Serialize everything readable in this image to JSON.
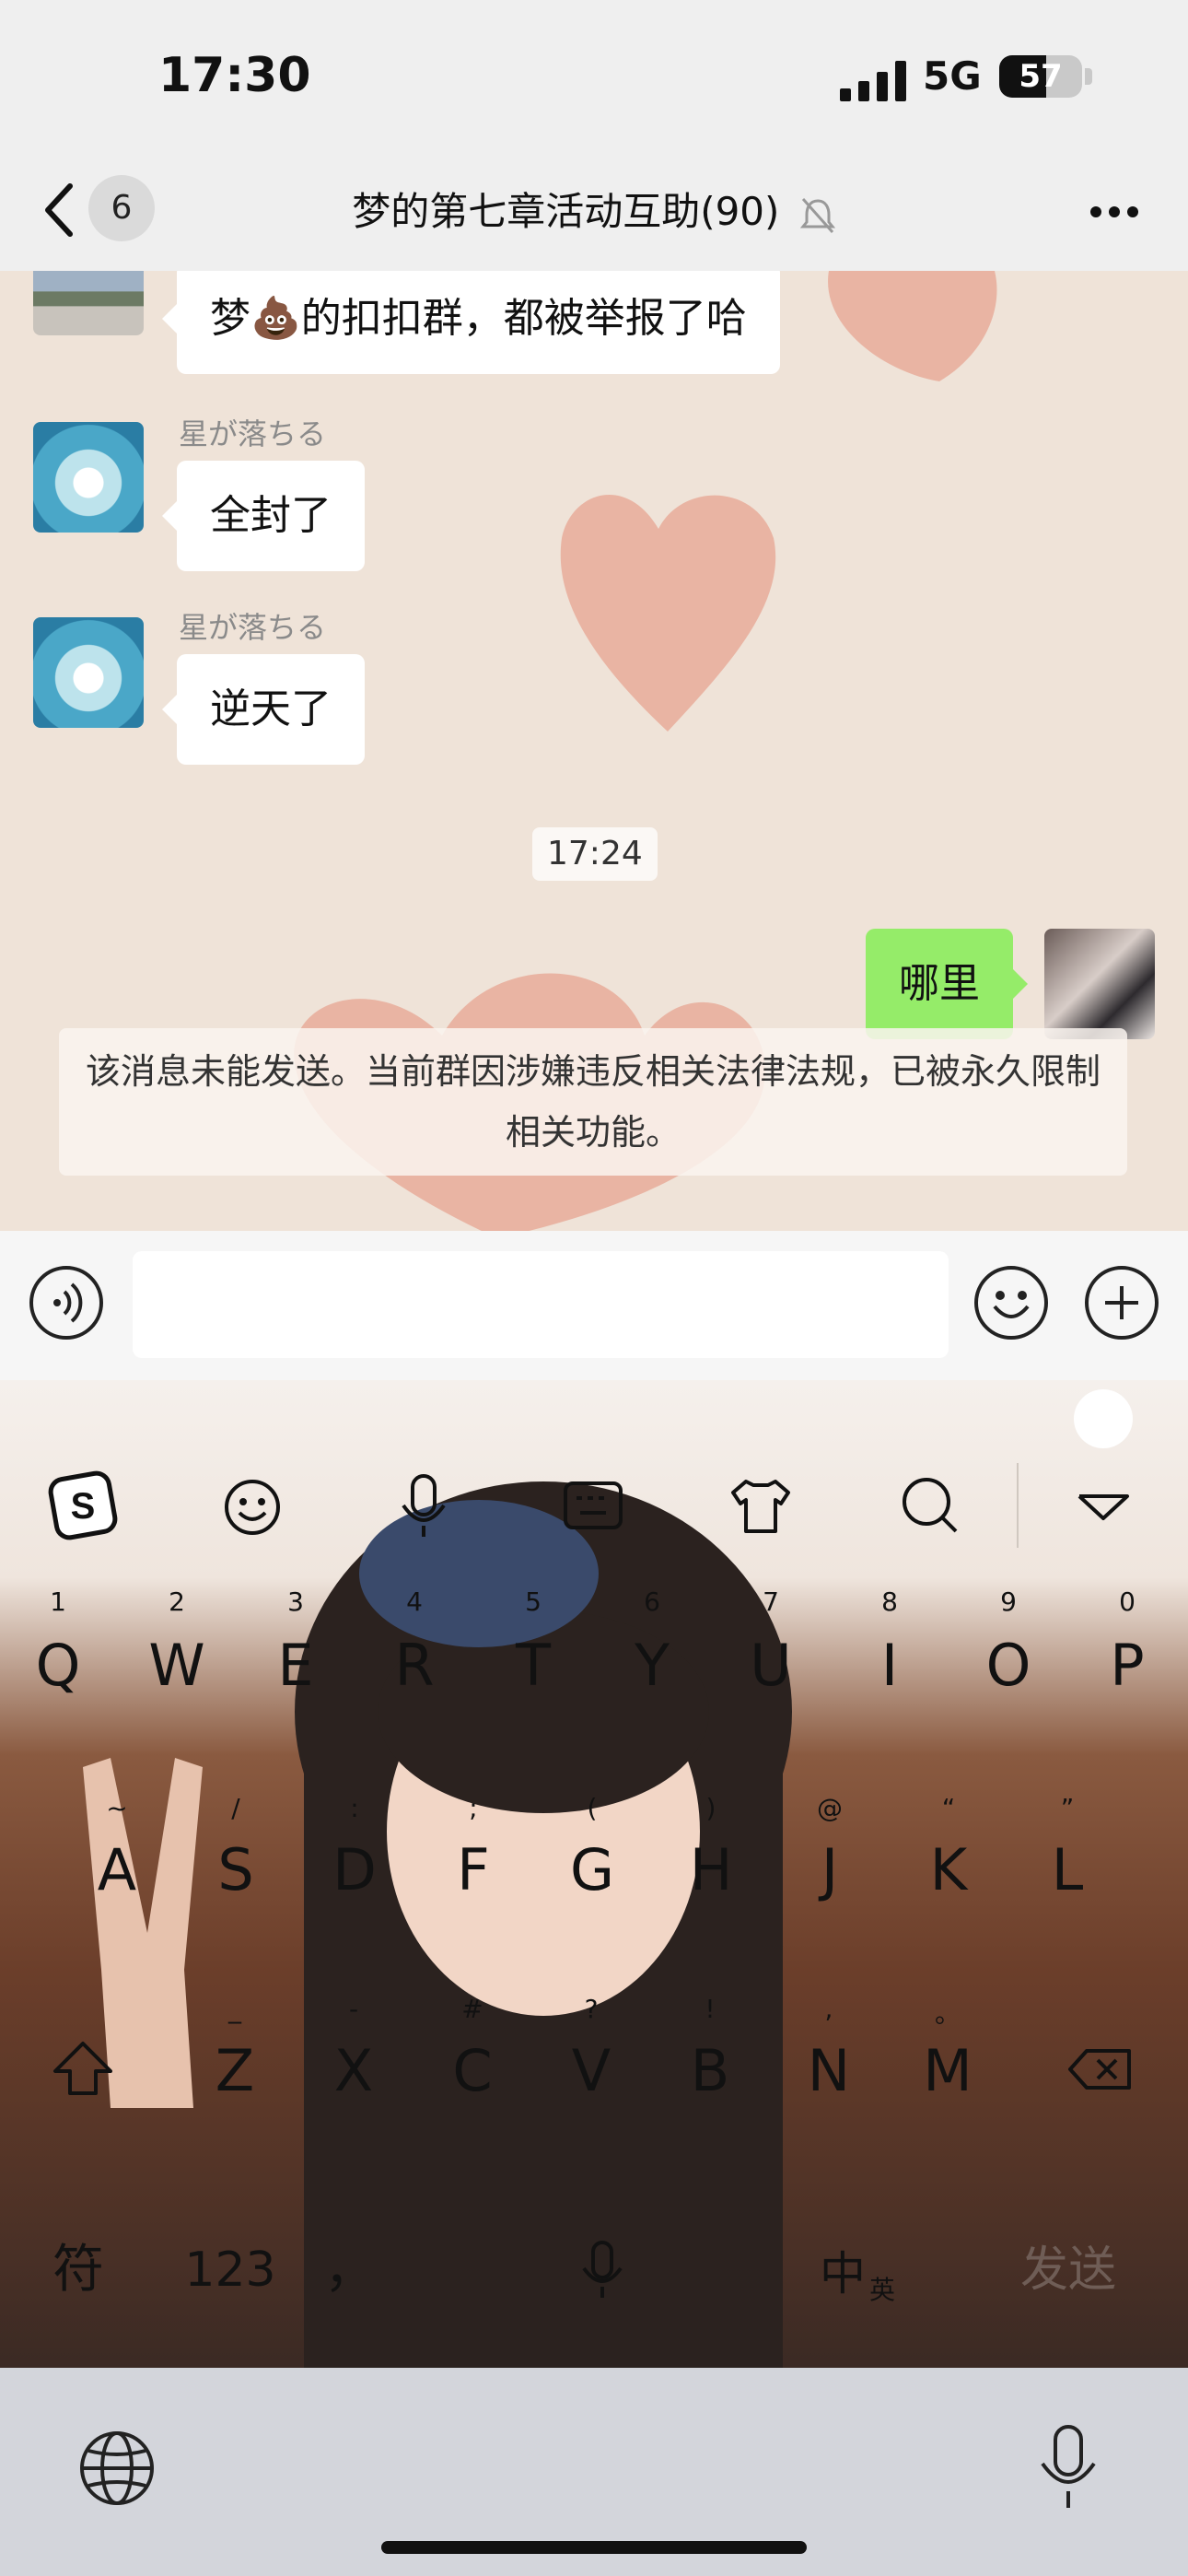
{
  "status_bar": {
    "time": "17:30",
    "network": "5G",
    "battery": "57",
    "battery_level": 0.57
  },
  "nav": {
    "back_icon": "chevron-left-icon",
    "unread_count": "6",
    "title": "梦的第七章活动互助(90)",
    "mute_icon": "bell-slash-icon",
    "more_icon": "ellipsis-icon"
  },
  "messages": [
    {
      "text_before": "梦",
      "emoji": "💩",
      "text_after": "的扣扣群，都被举报了哈"
    },
    {
      "sender": "星が落ちる",
      "text": "全封了"
    },
    {
      "sender": "星が落ちる",
      "text": "逆天了"
    }
  ],
  "timestamp": "17:24",
  "my_message": {
    "text": "哪里"
  },
  "system_notice": "该消息未能发送。当前群因涉嫌违反相关法律法规，已被永久限制相关功能。",
  "input_bar": {
    "voice_icon": "voice-icon",
    "emoji_icon": "smiley-icon",
    "plus_icon": "plus-circle-icon",
    "placeholder": ""
  },
  "keyboard": {
    "toolbar_icons": [
      "sogou-logo-icon",
      "emoji-icon",
      "microphone-icon",
      "keyboard-icon",
      "tshirt-icon",
      "search-icon",
      "collapse-triangle-icon"
    ],
    "row1_numbers": [
      "1",
      "2",
      "3",
      "4",
      "5",
      "6",
      "7",
      "8",
      "9",
      "0"
    ],
    "row1": [
      "Q",
      "W",
      "E",
      "R",
      "T",
      "Y",
      "U",
      "I",
      "O",
      "P"
    ],
    "row2_symbols": [
      "~",
      "/",
      ":",
      ";",
      "(",
      ")",
      "@",
      "“",
      "”"
    ],
    "row2": [
      "A",
      "S",
      "D",
      "F",
      "G",
      "H",
      "J",
      "K",
      "L"
    ],
    "row3_symbols": [
      "_",
      "-",
      "#",
      "?",
      "!",
      ",",
      "。"
    ],
    "row3": [
      "Z",
      "X",
      "C",
      "V",
      "B",
      "N",
      "M"
    ],
    "bottom": {
      "symbols": "符",
      "numbers": "123",
      "comma": "，",
      "lang_main": "中",
      "lang_sub": "英",
      "send": "发送"
    }
  },
  "system_bar": {
    "globe_icon": "globe-icon",
    "dictation_icon": "microphone-icon"
  }
}
